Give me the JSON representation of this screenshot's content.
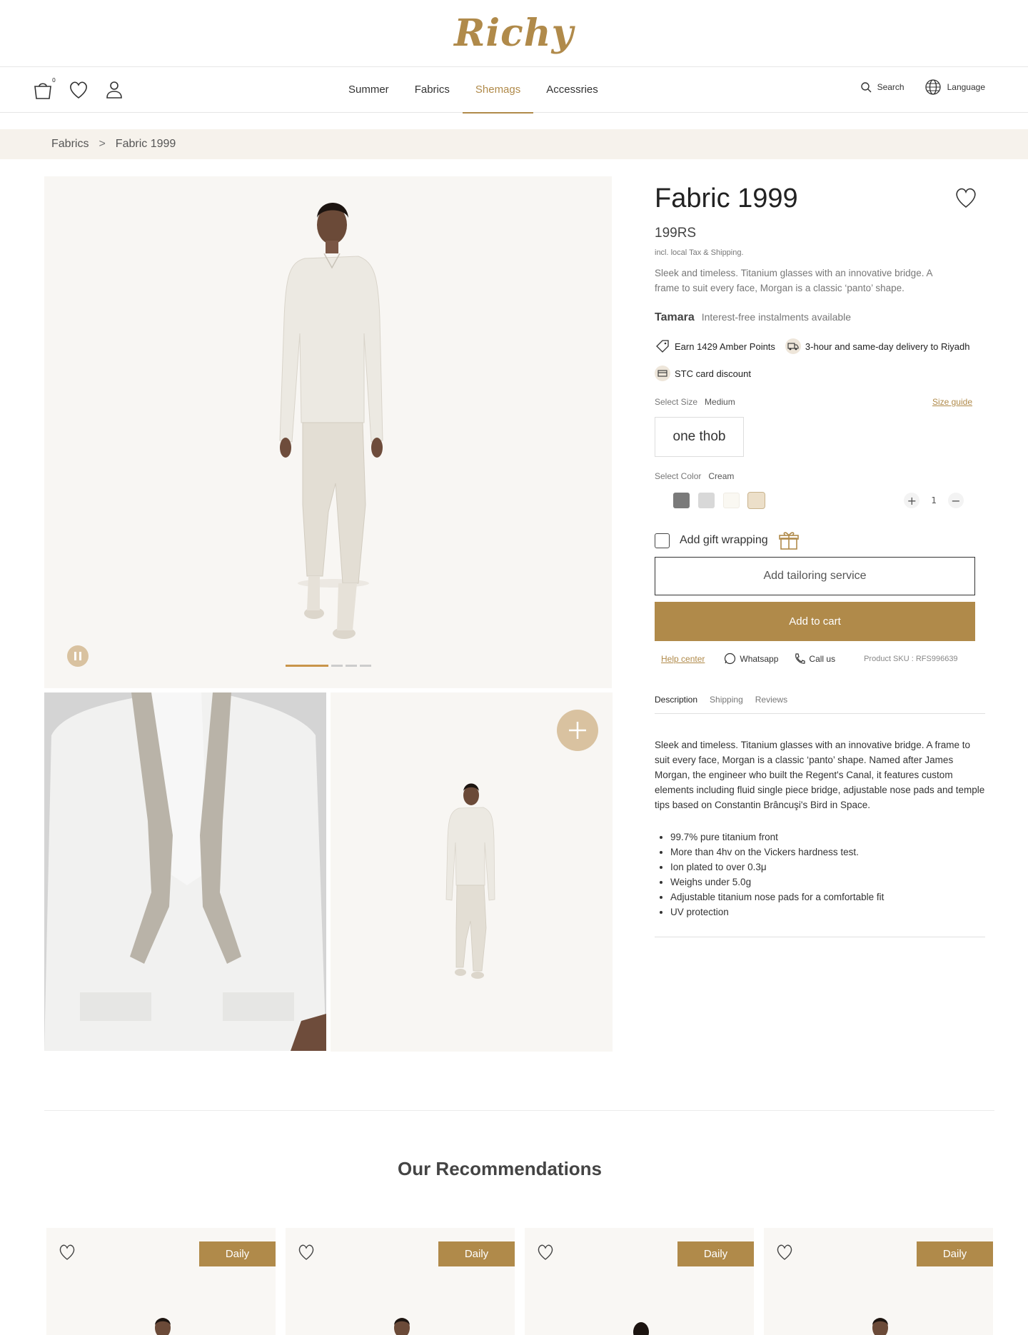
{
  "brand": {
    "logo": "Richy"
  },
  "header": {
    "cart_count": "0",
    "nav": [
      {
        "label": "Summer",
        "active": false
      },
      {
        "label": "Fabrics",
        "active": false
      },
      {
        "label": "Shemags",
        "active": true
      },
      {
        "label": "Accessries",
        "active": false
      }
    ],
    "search_label": "Search",
    "language_label": "Language"
  },
  "breadcrumb": {
    "items": [
      "Fabrics",
      "Fabric 1999"
    ],
    "separator": ">"
  },
  "gallery": {
    "slides": 4,
    "active_slide": 1
  },
  "product": {
    "title": "Fabric 1999",
    "price": "199RS",
    "tax_note": "incl. local Tax & Shipping.",
    "short_description": "Sleek and timeless. Titanium glasses with an innovative bridge. A frame to suit every face, Morgan is a classic ‘panto’ shape.",
    "tamara": {
      "name": "Tamara",
      "text": "Interest-free instalments available"
    },
    "badges": {
      "points": "Earn 1429 Amber Points",
      "delivery": "3-hour and same-day delivery to Riyadh",
      "stc": "STC card discount"
    },
    "size": {
      "label": "Select Size",
      "value": "Medium",
      "guide": "Size guide",
      "option": "one thob"
    },
    "color": {
      "label": "Select Color",
      "value": "Cream",
      "swatches": [
        "#7a7a7a",
        "#d8d8d8",
        "#faf8f2",
        "#ecdfc9"
      ],
      "selected_index": 3
    },
    "quantity": {
      "value": "1",
      "plus": "+",
      "minus": "−"
    },
    "gift_label": "Add gift wrapping",
    "tailoring_label": "Add tailoring service",
    "add_to_cart_label": "Add to cart",
    "help": {
      "help_center": "Help center",
      "whatsapp": "Whatsapp",
      "call": "Call us",
      "sku": "Product SKU : RFS996639"
    },
    "tabs": [
      {
        "label": "Description",
        "active": true
      },
      {
        "label": "Shipping",
        "active": false
      },
      {
        "label": "Reviews",
        "active": false
      }
    ],
    "description": "Sleek and timeless. Titanium glasses with an innovative bridge. A frame to suit every face, Morgan is a classic ‘panto’ shape. Named after James Morgan, the engineer who built the Regent's Canal, it features custom elements including fluid single piece bridge, adjustable nose pads and temple tips based on Constantin Brâncuşi's Bird in Space.",
    "features": [
      "99.7% pure titanium front",
      "More than 4hv on the Vickers hardness test.",
      "Ion plated to over 0.3μ",
      "Weighs under 5.0g",
      "Adjustable titanium nose pads for a comfortable fit",
      "UV protection"
    ]
  },
  "recommendations": {
    "title": "Our Recommendations",
    "cards": [
      {
        "tag": "Daily"
      },
      {
        "tag": "Daily"
      },
      {
        "tag": "Daily"
      },
      {
        "tag": "Daily"
      }
    ]
  },
  "colors": {
    "accent": "#b08a4a",
    "accent_light": "#d9c2a0",
    "breadcrumb_bg": "#f6f2ec"
  }
}
